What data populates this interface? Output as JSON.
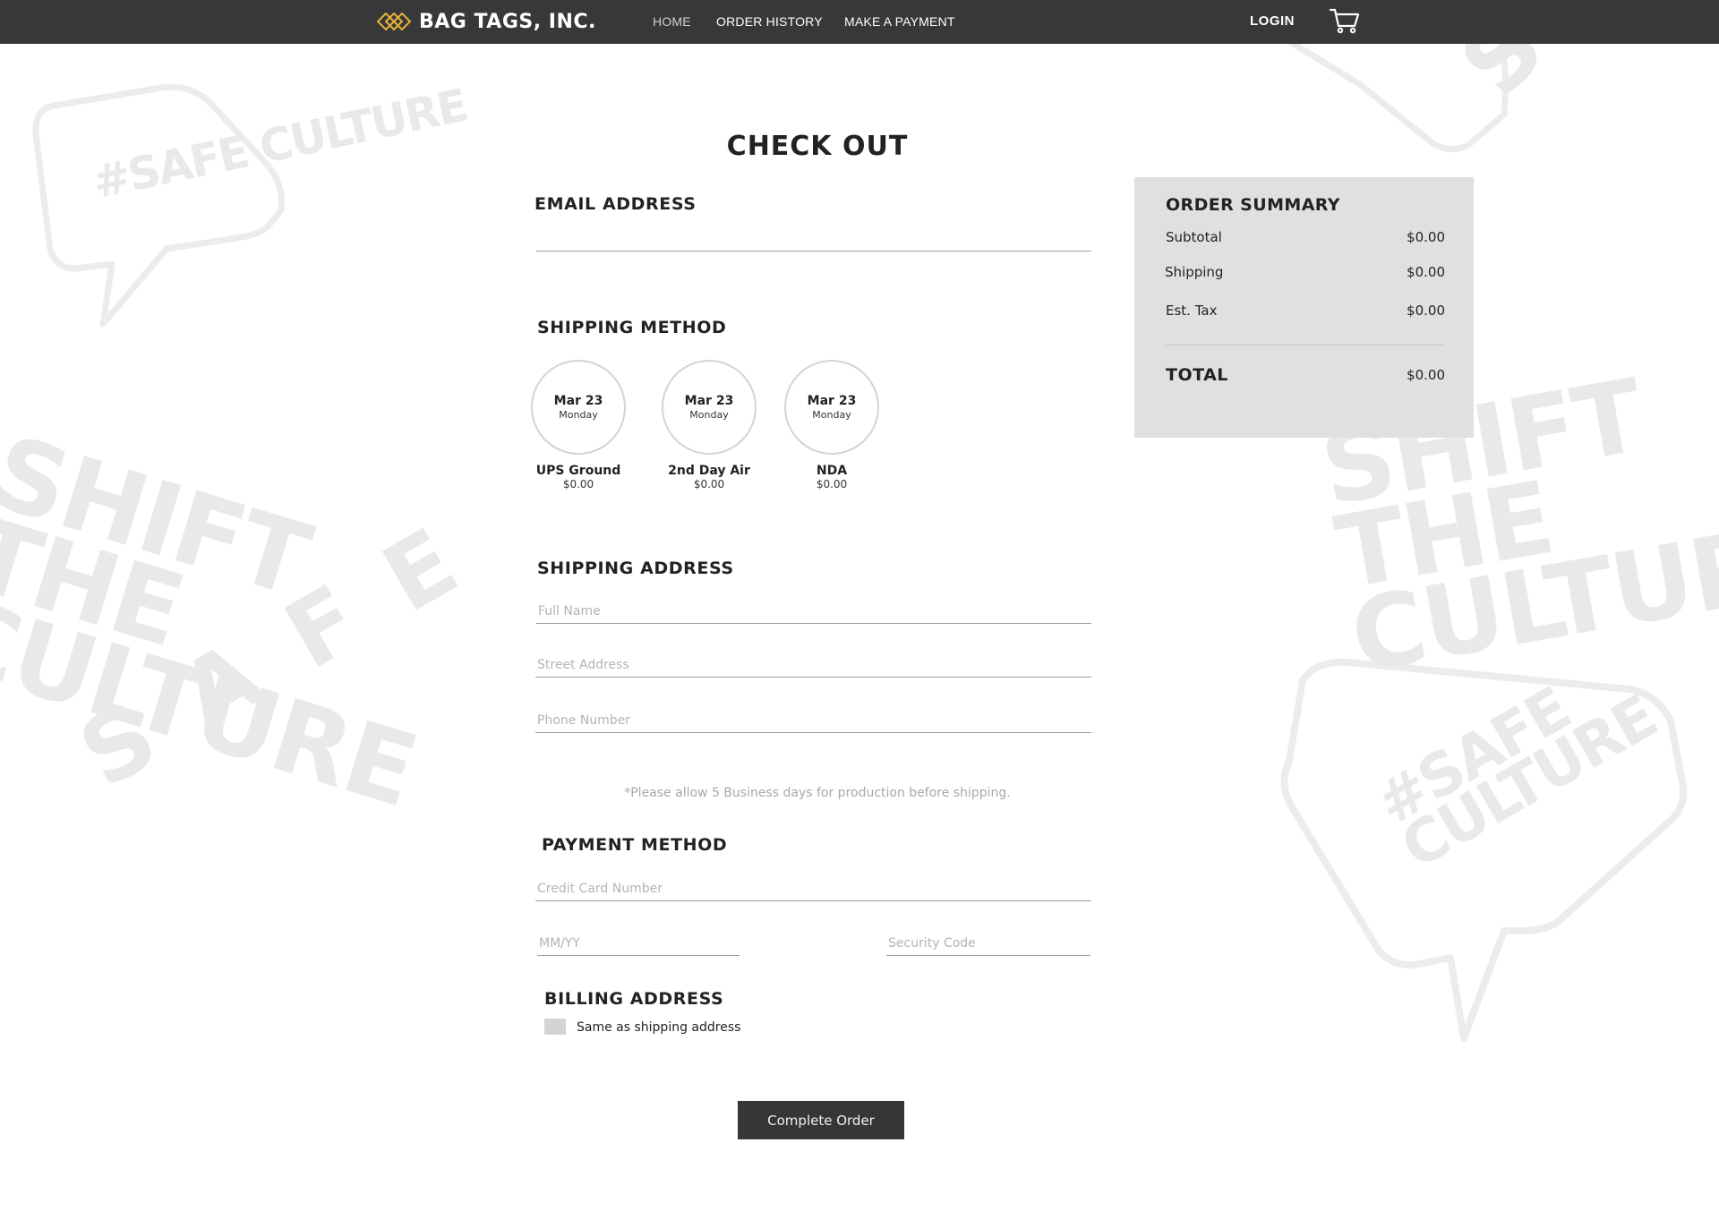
{
  "header": {
    "brand": "BAG TAGS, INC.",
    "nav": {
      "home": "HOME",
      "order_history": "ORDER HISTORY",
      "make_payment": "MAKE A PAYMENT"
    },
    "login": "LOGIN",
    "cart_icon": "shopping-cart-icon",
    "logo_icon": "diamond-logo-icon",
    "logo_color": "#e8b23a",
    "bar_color": "#383838"
  },
  "background": {
    "texts": [
      "#SAFE CULTURE",
      "SHIFT THE CULTURE",
      "SAFE",
      "SHIFT THE CULTURE",
      "#SAFE CULTURE",
      "SAFE"
    ]
  },
  "page": {
    "title": "CHECK OUT"
  },
  "email": {
    "label": "EMAIL ADDRESS",
    "value": "",
    "placeholder": ""
  },
  "shipping_method": {
    "label": "SHIPPING METHOD",
    "options": [
      {
        "date": "Mar 23",
        "day": "Monday",
        "name": "UPS Ground",
        "price": "$0.00"
      },
      {
        "date": "Mar 23",
        "day": "Monday",
        "name": "2nd Day Air",
        "price": "$0.00"
      },
      {
        "date": "Mar 23",
        "day": "Monday",
        "name": "NDA",
        "price": "$0.00"
      }
    ]
  },
  "shipping_address": {
    "label": "SHIPPING ADDRESS",
    "full_name_placeholder": "Full Name",
    "street_placeholder": "Street Address",
    "phone_placeholder": "Phone Number"
  },
  "production_note": "*Please allow 5 Business days for production before shipping.",
  "payment_method": {
    "label": "PAYMENT METHOD",
    "card_placeholder": "Credit Card Number",
    "expiry_placeholder": "MM/YY",
    "security_placeholder": "Security Code"
  },
  "billing_address": {
    "label": "BILLING ADDRESS",
    "same_as_shipping": "Same as shipping address",
    "same_as_shipping_checked": false
  },
  "complete_button": "Complete Order",
  "order_summary": {
    "title": "ORDER SUMMARY",
    "subtotal_label": "Subtotal",
    "subtotal": "$0.00",
    "shipping_label": "Shipping",
    "shipping": "$0.00",
    "tax_label": "Est. Tax",
    "tax": "$0.00",
    "total_label": "TOTAL",
    "total": "$0.00",
    "background_color": "#e1e0e0"
  }
}
